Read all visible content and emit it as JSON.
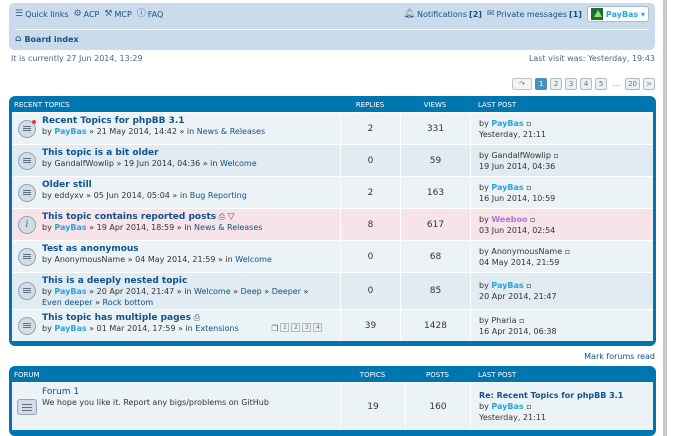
{
  "nav": {
    "quick_links": "Quick links",
    "acp": "ACP",
    "mcp": "MCP",
    "faq": "FAQ",
    "notifications": "Notifications",
    "notifications_count": "[2]",
    "private_messages": "Private messages",
    "pm_count": "[1]",
    "username": "PayBas ▾",
    "board_index": "Board index"
  },
  "time": {
    "current": "It is currently 27 Jun 2014, 13:29",
    "last_visit": "Last visit was: Yesterday, 19:43"
  },
  "pagination": [
    "1",
    "2",
    "3",
    "4",
    "5",
    "…",
    "20",
    ">"
  ],
  "topics_header": {
    "title": "RECENT TOPICS",
    "replies": "REPLIES",
    "views": "VIEWS",
    "last_post": "LAST POST"
  },
  "topics": [
    {
      "title": "Recent Topics for phpBB 3.1",
      "by": "by ",
      "author": "PayBas",
      "date": " » 21 May 2014, 14:42 » in ",
      "forum": "News & Releases",
      "replies": "2",
      "views": "331",
      "last_by": "by ",
      "last_author": "PayBas",
      "last_time": "Yesterday, 21:11"
    },
    {
      "title": "This topic is a bit older",
      "by": "by ",
      "author": "GandalfWowlip",
      "date": " » 19 Jun 2014, 04:36 » in ",
      "forum": "Welcome",
      "replies": "0",
      "views": "59",
      "last_by": "by ",
      "last_author": "GandalfWowlip",
      "last_time": "19 Jun 2014, 04:36"
    },
    {
      "title": "Older still",
      "by": "by ",
      "author": "eddyxv",
      "date": " » 05 Jun 2014, 05:04 » in ",
      "forum": "Bug Reporting",
      "replies": "2",
      "views": "163",
      "last_by": "by ",
      "last_author": "PayBas",
      "last_time": "16 Jun 2014, 10:59"
    },
    {
      "title": "This topic contains reported posts",
      "by": "by ",
      "author": "PayBas",
      "date": " » 19 Apr 2014, 18:59 » in ",
      "forum": "News & Releases",
      "replies": "8",
      "views": "617",
      "last_by": "by ",
      "last_author": "Weeboo",
      "last_time": "03 Jun 2014, 02:54"
    },
    {
      "title": "Test as anonymous",
      "by": "by ",
      "author": "AnonymousName",
      "date": " » 04 May 2014, 21:59 » in ",
      "forum": "Welcome",
      "replies": "0",
      "views": "68",
      "last_by": "by ",
      "last_author": "AnonymousName",
      "last_time": "04 May 2014, 21:59"
    },
    {
      "title": "This is a deeply nested topic",
      "by": "by ",
      "author": "PayBas",
      "date": " » 20 Apr 2014, 21:47 » in ",
      "forum": "Welcome",
      "nested": [
        "Deep",
        "Deeper",
        "Even deeper",
        "Rock bottom"
      ],
      "replies": "0",
      "views": "85",
      "last_by": "by ",
      "last_author": "PayBas",
      "last_time": "20 Apr 2014, 21:47"
    },
    {
      "title": "This topic has multiple pages",
      "by": "by ",
      "author": "PayBas",
      "date": " » 01 Mar 2014, 17:59 » in ",
      "forum": "Extensions",
      "pages": [
        "1",
        "2",
        "3",
        "4"
      ],
      "replies": "39",
      "views": "1428",
      "last_by": "by ",
      "last_author": "Pharia",
      "last_time": "16 Apr 2014, 06:38"
    }
  ],
  "mark_read": "Mark forums read",
  "forums_header": {
    "title": "FORUM",
    "topics": "TOPICS",
    "posts": "POSTS",
    "last_post": "LAST POST"
  },
  "forums": [
    {
      "title": "Forum 1",
      "desc": "We hope you like it. Report any bigs/problems on GitHub",
      "topics": "19",
      "posts": "160",
      "last_title": "Re: Recent Topics for phpBB 3.1",
      "last_by": "by ",
      "last_author": "PayBas",
      "last_time": "Yesterday, 21:11"
    }
  ],
  "colors": {
    "header_blue": "#0076b1",
    "navbar": "#cadceb",
    "username": "#2aa3d9",
    "reported_row": "#f7e4e8"
  }
}
